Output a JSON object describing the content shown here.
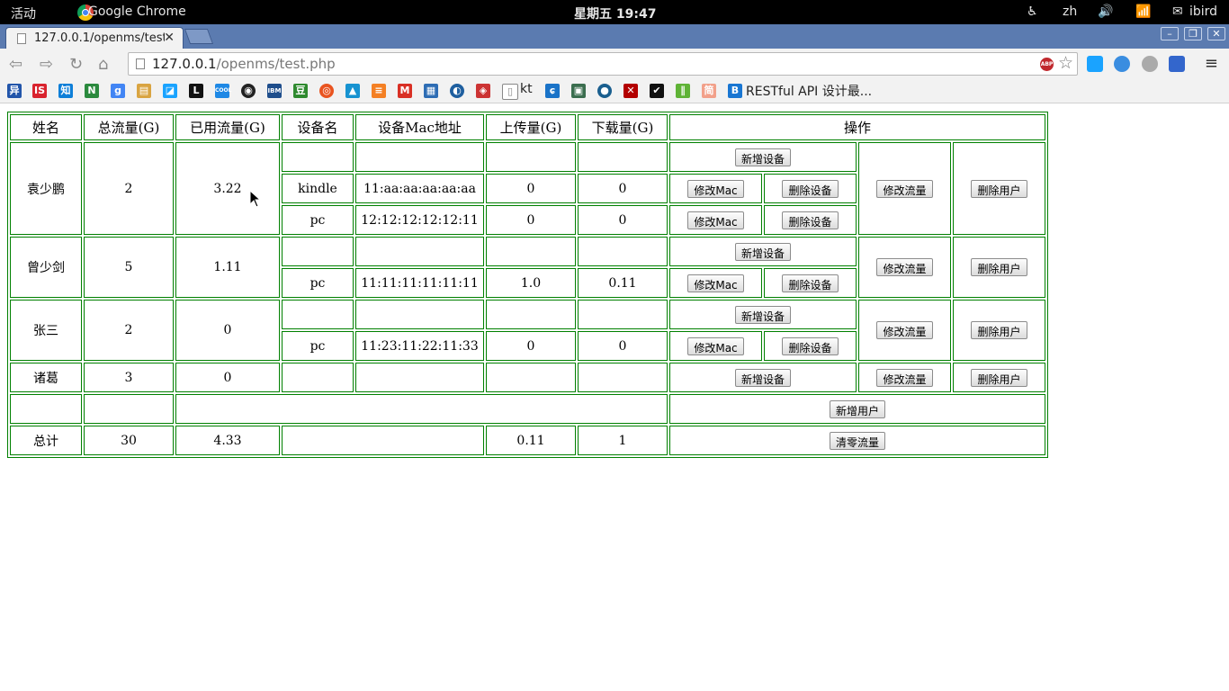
{
  "system": {
    "activities": "活动",
    "app_name": "Google Chrome",
    "clock": "星期五 19:47",
    "lang": "zh",
    "user": "ibird"
  },
  "browser": {
    "tab_title": "127.0.0.1/openms/test.php",
    "url_host": "127.0.0.1",
    "url_path": "/openms/test.php",
    "bookmark_kt": "kt",
    "bookmark_restful": "RESTful API 设计最..."
  },
  "table": {
    "headers": [
      "姓名",
      "总流量(G)",
      "已用流量(G)",
      "设备名",
      "设备Mac地址",
      "上传量(G)",
      "下载量(G)",
      "操作"
    ],
    "users": [
      {
        "name": "袁少鹏",
        "total": "2",
        "used": "3.22",
        "devices": [
          {
            "name": "kindle",
            "mac": "11:aa:aa:aa:aa:aa",
            "up": "0",
            "down": "0"
          },
          {
            "name": "pc",
            "mac": "12:12:12:12:12:11",
            "up": "0",
            "down": "0"
          }
        ]
      },
      {
        "name": "曾少剑",
        "total": "5",
        "used": "1.11",
        "devices": [
          {
            "name": "pc",
            "mac": "11:11:11:11:11:11",
            "up": "1.0",
            "down": "0.11"
          }
        ]
      },
      {
        "name": "张三",
        "total": "2",
        "used": "0",
        "devices": [
          {
            "name": "pc",
            "mac": "11:23:11:22:11:33",
            "up": "0",
            "down": "0"
          }
        ]
      },
      {
        "name": "诸葛",
        "total": "3",
        "used": "0",
        "devices": []
      }
    ],
    "totals": {
      "label": "总计",
      "total": "30",
      "used": "4.33",
      "up": "0.11",
      "down": "1"
    },
    "buttons": {
      "add_device": "新增设备",
      "modify_mac": "修改Mac",
      "delete_device": "删除设备",
      "modify_flow": "修改流量",
      "delete_user": "删除用户",
      "add_user": "新增用户",
      "reset_flow": "清零流量"
    }
  }
}
